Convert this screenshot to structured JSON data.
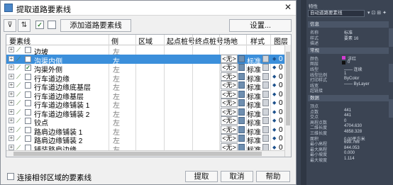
{
  "dialog": {
    "title": "提取道路要素线",
    "close": "✕",
    "toolbar": {
      "filter_icon": "filter-icon",
      "sort_icon": "sort-icon",
      "check1": "✓",
      "check2": "",
      "add_button": "添加道路要素线",
      "settings_button": "设置..."
    },
    "columns": [
      "要素线",
      "侧",
      "区域",
      "起点桩号",
      "终点桩号",
      "场地",
      "样式",
      "图层"
    ],
    "rows": [
      {
        "name": "边坡",
        "side": "左",
        "checked": false,
        "site": "",
        "style": "",
        "layer": ""
      },
      {
        "name": "沟渠内侧",
        "side": "左",
        "checked": false,
        "selected": true,
        "site": "<无>",
        "style": "标准",
        "layer": "0"
      },
      {
        "name": "沟渠外侧",
        "side": "左",
        "checked": true,
        "site": "<无>",
        "style": "标准",
        "layer": "0"
      },
      {
        "name": "行车道边缘",
        "side": "左",
        "checked": false,
        "site": "<无>",
        "style": "标准",
        "layer": "0"
      },
      {
        "name": "行车道边缘底基层",
        "side": "左",
        "checked": false,
        "site": "<无>",
        "style": "标准",
        "layer": "0"
      },
      {
        "name": "行车道边缘基层",
        "side": "左",
        "checked": false,
        "site": "<无>",
        "style": "标准",
        "layer": "0"
      },
      {
        "name": "行车道边缘铺装 1",
        "side": "左",
        "checked": false,
        "site": "<无>",
        "style": "标准",
        "layer": "0"
      },
      {
        "name": "行车道边缘铺装 2",
        "side": "左",
        "checked": false,
        "site": "<无>",
        "style": "标准",
        "layer": "0"
      },
      {
        "name": "铰点",
        "side": "左",
        "checked": false,
        "site": "<无>",
        "style": "标准",
        "layer": "0"
      },
      {
        "name": "路肩边缘铺装 1",
        "side": "左",
        "checked": false,
        "site": "<无>",
        "style": "标准",
        "layer": "0"
      },
      {
        "name": "路肩边缘铺装 2",
        "side": "左",
        "checked": false,
        "site": "<无>",
        "style": "标准",
        "layer": "0"
      },
      {
        "name": "铺装路肩边缘",
        "side": "左",
        "checked": false,
        "site": "<无>",
        "style": "标准",
        "layer": "0"
      }
    ],
    "bottom_checkbox_label": "连接相邻区域的要素线",
    "buttons": {
      "extract": "提取",
      "cancel": "取消",
      "help": "帮助"
    }
  },
  "palette": {
    "title": "特性",
    "dropdown": "自动道路要素线",
    "tools": "▾ ⊡ ⊞ ✦",
    "sections": [
      {
        "name": "信息",
        "rows": [
          [
            "名称",
            "标准"
          ],
          [
            "样式",
            "要素 16"
          ],
          [
            "描述",
            ""
          ]
        ]
      },
      {
        "name": "常规",
        "rows": [
          [
            "颜色",
            "洋红"
          ],
          [
            "图层",
            "0"
          ],
          [
            "线型",
            "—— 连续"
          ],
          [
            "线型比例",
            "1"
          ],
          [
            "打印样式",
            "ByColor"
          ],
          [
            "线宽",
            "—— ByLayer"
          ],
          [
            "超链接",
            ""
          ]
        ]
      },
      {
        "name": "数据",
        "rows": [
          [
            "顶点",
            ""
          ],
          [
            "点数",
            "441"
          ],
          [
            "交点",
            "441"
          ],
          [
            "高程点数",
            "0"
          ],
          [
            "二维长度",
            "4704.630"
          ],
          [
            "三维长度",
            "4858.328"
          ],
          [
            "面积",
            "0.00平方米"
          ],
          [
            "最小高程",
            "699.766"
          ],
          [
            "最大高程",
            "844.053"
          ],
          [
            "最小坡度",
            "0.000"
          ],
          [
            "最大坡度",
            "1.114"
          ]
        ]
      }
    ],
    "colors": {
      "magenta": "#d23cd2",
      "black": "#111111"
    }
  }
}
